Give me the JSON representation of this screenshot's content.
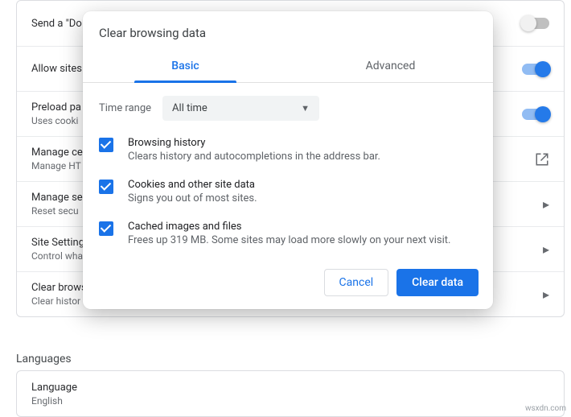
{
  "settings": {
    "rows": [
      {
        "title": "Send a \"Do Not Track\" request with your browsing traffic",
        "sub": ""
      },
      {
        "title": "Allow sites",
        "sub": ""
      },
      {
        "title": "Preload pa",
        "sub": "Uses cooki"
      },
      {
        "title": "Manage ce",
        "sub": "Manage HT"
      },
      {
        "title": "Manage se",
        "sub": "Reset secu"
      },
      {
        "title": "Site Setting",
        "sub": "Control wha"
      },
      {
        "title": "Clear brows",
        "sub": "Clear histor"
      }
    ]
  },
  "section_header": "Languages",
  "language_row": {
    "title": "Language",
    "sub": "English"
  },
  "modal": {
    "title": "Clear browsing data",
    "tabs": {
      "basic": "Basic",
      "advanced": "Advanced"
    },
    "time_label": "Time range",
    "time_value": "All time",
    "options": [
      {
        "title": "Browsing history",
        "sub": "Clears history and autocompletions in the address bar."
      },
      {
        "title": "Cookies and other site data",
        "sub": "Signs you out of most sites."
      },
      {
        "title": "Cached images and files",
        "sub": "Frees up 319 MB. Some sites may load more slowly on your next visit."
      }
    ],
    "cancel": "Cancel",
    "clear": "Clear data"
  },
  "watermark": "wsxdn.com"
}
